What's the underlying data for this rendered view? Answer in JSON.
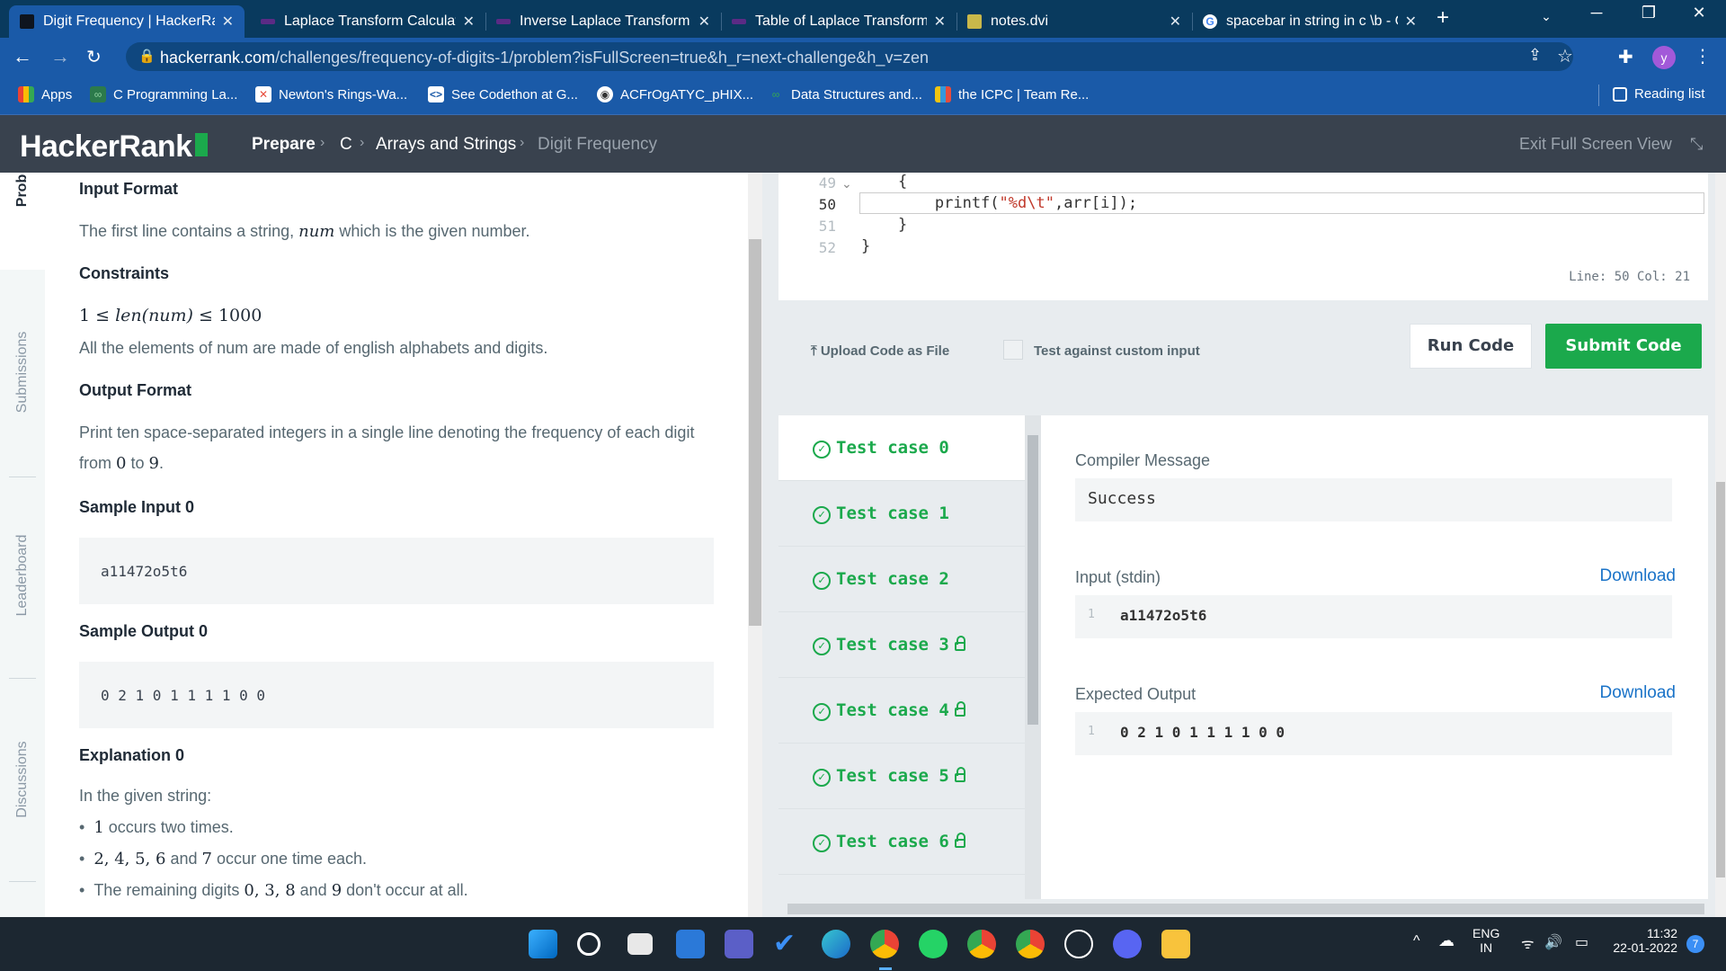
{
  "browser": {
    "tabs": [
      {
        "title": "Digit Frequency | HackerRank",
        "active": true
      },
      {
        "title": "Laplace Transform Calculator"
      },
      {
        "title": "Inverse Laplace Transform Calculator"
      },
      {
        "title": "Table of Laplace Transforms"
      },
      {
        "title": "notes.dvi"
      },
      {
        "title": "spacebar in string in c \\b - Google Search"
      }
    ],
    "url_host": "hackerrank.com",
    "url_path": "/challenges/frequency-of-digits-1/problem?isFullScreen=true&h_r=next-challenge&h_v=zen",
    "profile_initial": "y",
    "bookmarks": [
      "Apps",
      "C Programming La...",
      "Newton's Rings-Wa...",
      "See Codethon at G...",
      "ACFrOgATYC_pHIX...",
      "Data Structures and...",
      "the ICPC | Team Re..."
    ],
    "reading_list": "Reading list"
  },
  "header": {
    "logo": "HackerRank",
    "crumbs": [
      "Prepare",
      "C",
      "Arrays and Strings",
      "Digit Frequency"
    ],
    "exit_fullscreen": "Exit Full Screen View"
  },
  "side_tabs": {
    "problem": "Prob",
    "submissions": "Submissions",
    "leaderboard": "Leaderboard",
    "discussions": "Discussions"
  },
  "problem": {
    "input_format_heading": "Input Format",
    "input_format_pre": "The first line contains a string, ",
    "input_format_var": "num",
    "input_format_post": " which is the given number.",
    "constraints_heading": "Constraints",
    "constraint_a": "1 ≤ ",
    "constraint_b": "len(num)",
    "constraint_c": " ≤ 1000",
    "constraint_text": "All the elements of num are made of english alphabets and digits.",
    "output_format_heading": "Output Format",
    "output_format_line1": "Print ten space-separated integers in a single line denoting the frequency of each digit",
    "output_format_from": "from ",
    "output_format_zero": "0",
    "output_format_to": " to ",
    "output_format_nine": "9",
    "output_format_dot": ".",
    "sample_input_heading": "Sample Input 0",
    "sample_input": "a11472o5t6",
    "sample_output_heading": "Sample Output 0",
    "sample_output": "0 2 1 0 1 1 1 1 0 0",
    "explanation_heading": "Explanation 0",
    "explanation_intro": "In the given string:",
    "bullet1_num": "1",
    "bullet1_text": " occurs two times.",
    "bullet2_num": "2, 4, 5, 6",
    "bullet2_and": " and ",
    "bullet2_num2": "7",
    "bullet2_text": " occur one time each.",
    "bullet3_pre": "The remaining digits ",
    "bullet3_nums": "0, 3, 8",
    "bullet3_and": " and ",
    "bullet3_nine": "9",
    "bullet3_text": " don't occur at all."
  },
  "editor": {
    "lines": [
      {
        "n": "49",
        "code": "    {"
      },
      {
        "n": "50",
        "code_pre": "        printf(",
        "code_str": "\"%d\\t\"",
        "code_post": ",arr[i]);"
      },
      {
        "n": "51",
        "code": "    }"
      },
      {
        "n": "52",
        "code": "}"
      }
    ],
    "status": "Line: 50 Col: 21",
    "upload_label": "Upload Code as File",
    "custom_input_label": "Test against custom input",
    "run_label": "Run Code",
    "submit_label": "Submit Code"
  },
  "results": {
    "test_cases": [
      {
        "label": "Test case 0",
        "locked": false
      },
      {
        "label": "Test case 1",
        "locked": false
      },
      {
        "label": "Test case 2",
        "locked": false
      },
      {
        "label": "Test case 3",
        "locked": true
      },
      {
        "label": "Test case 4",
        "locked": true
      },
      {
        "label": "Test case 5",
        "locked": true
      },
      {
        "label": "Test case 6",
        "locked": true
      }
    ],
    "compiler_message_label": "Compiler Message",
    "compiler_message": "Success",
    "input_label": "Input (stdin)",
    "input_line_no": "1",
    "input_value": "a11472o5t6",
    "expected_label": "Expected Output",
    "expected_line_no": "1",
    "expected_value": "0 2 1 0 1 1 1 1 0 0",
    "download_label": "Download"
  },
  "taskbar": {
    "lang_top": "ENG",
    "lang_bottom": "IN",
    "time": "11:32",
    "date": "22-01-2022",
    "notifications": "7"
  },
  "colors": {
    "hr_green": "#1ba94c",
    "hr_header": "#39424e",
    "browser_blue": "#1a5aa8"
  }
}
